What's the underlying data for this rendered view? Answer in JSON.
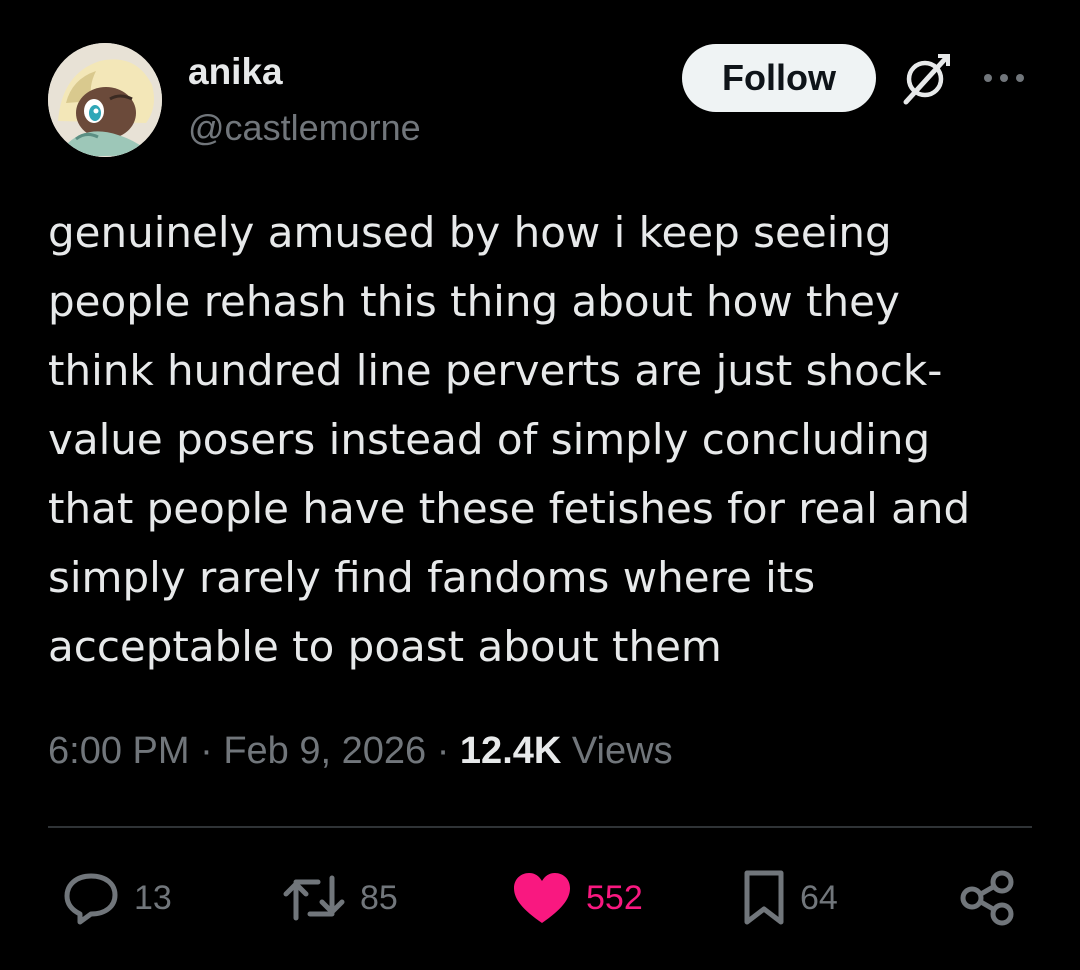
{
  "author": {
    "display_name": "anika",
    "handle": "@castlemorne",
    "avatar_icon": "anime-avatar-icon"
  },
  "header": {
    "follow_label": "Follow",
    "grok_icon": "grok-icon",
    "more_icon": "more-icon"
  },
  "tweet": {
    "lines": [
      "genuinely amused by how i keep seeing",
      "people rehash this thing about how they",
      "think hundred line perverts are just shock-",
      "value posers instead of simply concluding",
      "that people have these fetishes for real and",
      "simply rarely find fandoms where its",
      "acceptable to poast about them"
    ]
  },
  "meta": {
    "time": "6:00 PM",
    "separator": " · ",
    "date": "Feb 9, 2026",
    "views_count": "12.4K",
    "views_label": " Views"
  },
  "actions": {
    "reply": {
      "icon": "reply-icon",
      "count": "13"
    },
    "retweet": {
      "icon": "retweet-icon",
      "count": "85"
    },
    "like": {
      "icon": "heart-icon",
      "count": "552",
      "liked": true
    },
    "bookmark": {
      "icon": "bookmark-icon",
      "count": "64"
    },
    "share": {
      "icon": "share-icon"
    }
  },
  "colors": {
    "background": "#000000",
    "text": "#e7e9ea",
    "secondary": "#71767b",
    "like": "#f91880",
    "divider": "#2f3336"
  }
}
